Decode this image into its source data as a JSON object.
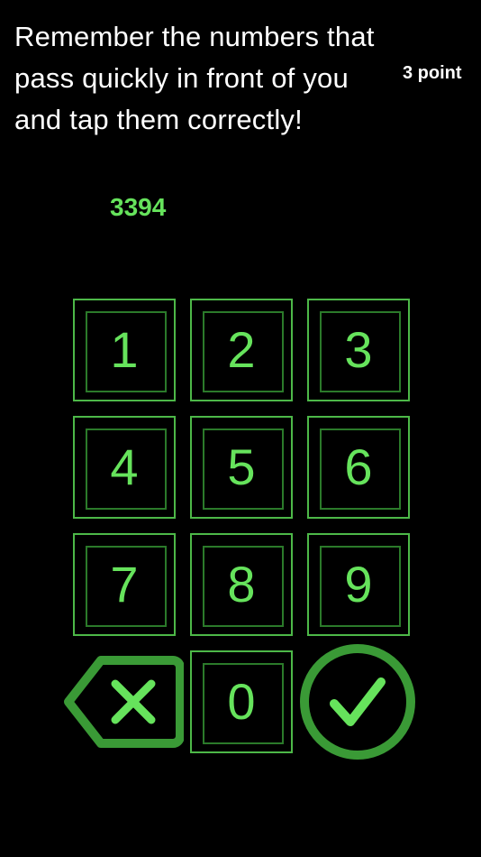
{
  "instructions": "Remember the numbers that pass quickly in front of you and tap them correctly!",
  "score": "3 point",
  "target_number": "3394",
  "colors": {
    "background": "#000000",
    "text": "#ffffff",
    "accent": "#66e35c",
    "border": "#4db848",
    "inner_border": "#2b7a2a",
    "icon_outline": "#3a9a36"
  },
  "keypad": {
    "keys": [
      {
        "label": "1"
      },
      {
        "label": "2"
      },
      {
        "label": "3"
      },
      {
        "label": "4"
      },
      {
        "label": "5"
      },
      {
        "label": "6"
      },
      {
        "label": "7"
      },
      {
        "label": "8"
      },
      {
        "label": "9"
      },
      {
        "label": "0"
      }
    ],
    "delete_icon": "backspace-x-icon",
    "confirm_icon": "checkmark-circle-icon"
  }
}
